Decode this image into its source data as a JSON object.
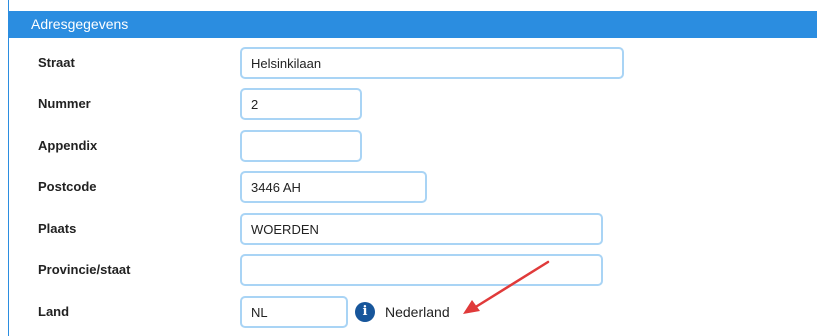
{
  "section": {
    "title": "Adresgegevens"
  },
  "fields": {
    "straat": {
      "label": "Straat",
      "value": "Helsinkilaan"
    },
    "nummer": {
      "label": "Nummer",
      "value": "2"
    },
    "appendix": {
      "label": "Appendix",
      "value": ""
    },
    "postcode": {
      "label": "Postcode",
      "value": "3446 AH"
    },
    "plaats": {
      "label": "Plaats",
      "value": "WOERDEN"
    },
    "provincie": {
      "label": "Provincie/staat",
      "value": ""
    },
    "land": {
      "label": "Land",
      "value": "NL",
      "country_name": "Nederland"
    }
  },
  "icons": {
    "info": "info-icon",
    "annotation": "red-arrow-annotation"
  },
  "colors": {
    "header_bg": "#2b8de0",
    "field_border": "#a9d4f5",
    "info_icon": "#17569b",
    "arrow": "#e03a3a"
  }
}
